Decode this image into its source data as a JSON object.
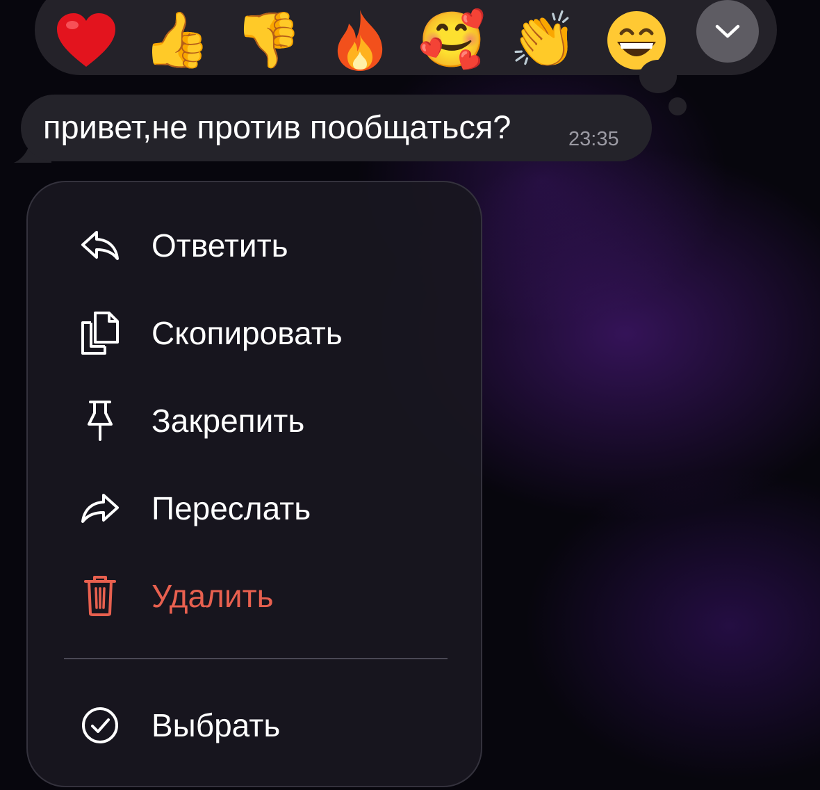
{
  "reactions": {
    "items": [
      {
        "name": "heart",
        "glyph": "❤️"
      },
      {
        "name": "thumbs-up",
        "glyph": "👍"
      },
      {
        "name": "thumbs-down",
        "glyph": "👎"
      },
      {
        "name": "fire",
        "glyph": "🔥"
      },
      {
        "name": "smiling-face-with-hearts",
        "glyph": "🥰"
      },
      {
        "name": "clapping-hands",
        "glyph": "👏"
      },
      {
        "name": "grinning-face",
        "glyph": "😁"
      }
    ],
    "expand_icon": "chevron-down-icon"
  },
  "message": {
    "text": "привет,не против пообщаться?",
    "time": "23:35"
  },
  "menu": {
    "reply": {
      "label": "Ответить",
      "icon": "reply-icon"
    },
    "copy": {
      "label": "Скопировать",
      "icon": "copy-icon"
    },
    "pin": {
      "label": "Закрепить",
      "icon": "pin-icon"
    },
    "forward": {
      "label": "Переслать",
      "icon": "forward-icon"
    },
    "delete": {
      "label": "Удалить",
      "icon": "trash-icon"
    },
    "select": {
      "label": "Выбрать",
      "icon": "check-circle-icon"
    }
  },
  "colors": {
    "background": "#07060d",
    "panel": "#242229",
    "menu": "#181620",
    "danger": "#e8604f",
    "time": "#9b9aa3",
    "text": "#ffffff"
  }
}
